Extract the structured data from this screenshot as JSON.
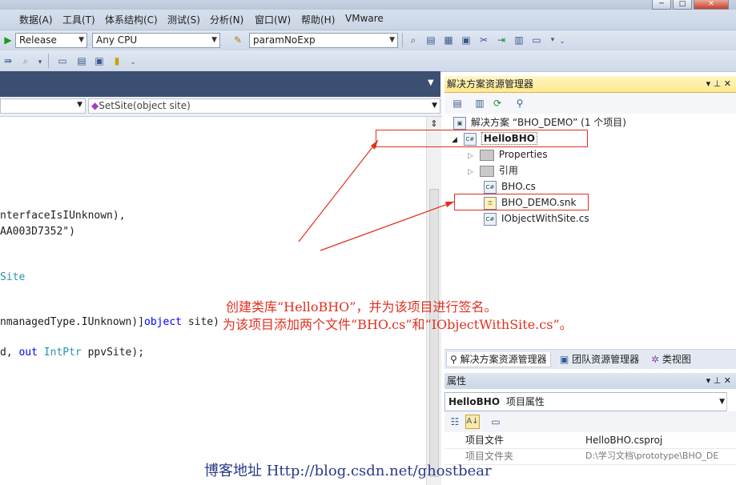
{
  "window_controls": [
    "─",
    "□",
    "✕"
  ],
  "menubar": {
    "items": [
      "数据(A)",
      "工具(T)",
      "体系结构(C)",
      "测试(S)",
      "分析(N)",
      "窗口(W)",
      "帮助(H)",
      "VMware"
    ]
  },
  "toolbar": {
    "configuration": "Release",
    "platform": "Any CPU",
    "find_text": "paramNoExp"
  },
  "navbar": {
    "member": "SetSite(object site)"
  },
  "code": {
    "line1": "nterfaceIsIUnknown),",
    "line2": "AA003D7352\")",
    "line3": "Site",
    "line4_pre": "nmanagedType.",
    "line4_mid": "IUnknown)]",
    "line4_kw": "object",
    "line4_post": " site)",
    "line5_pre": "d, ",
    "line5_kw": "out",
    "line5_type": "IntPtr",
    "line5_post": " ppvSite);"
  },
  "solution_explorer": {
    "title": "解决方案资源管理器",
    "pin": "▾ ⊥ ✕",
    "solution": "解决方案 “BHO_DEMO” (1 个项目)",
    "project": "HelloBHO",
    "items": [
      {
        "label": "Properties",
        "kind": "folder"
      },
      {
        "label": "引用",
        "kind": "folder"
      },
      {
        "label": "BHO.cs",
        "kind": "cs"
      },
      {
        "label": "BHO_DEMO.snk",
        "kind": "snk"
      },
      {
        "label": "IObjectWithSite.cs",
        "kind": "cs"
      }
    ]
  },
  "panel_tabs": [
    "解决方案资源管理器",
    "团队资源管理器",
    "类视图"
  ],
  "properties": {
    "title": "属性",
    "object_name": "HelloBHO",
    "object_type": "项目属性",
    "rows": [
      {
        "name": "项目文件",
        "value": "HelloBHO.csproj"
      },
      {
        "name": "项目文件夹",
        "value": "D:\\学习文档\\prototype\\BHO_DE"
      }
    ]
  },
  "annotation": {
    "line1": "创建类库“HelloBHO”，并为该项目进行签名。",
    "line2": "为该项目添加两个文件“BHO.cs”和“IObjectWithSite.cs”。"
  },
  "watermark": "博客地址 Http://blog.csdn.net/ghostbear",
  "colors": {
    "annotation": "#e03020",
    "doc_header": "#3b4f73",
    "panel_title": "#ffe88a"
  }
}
